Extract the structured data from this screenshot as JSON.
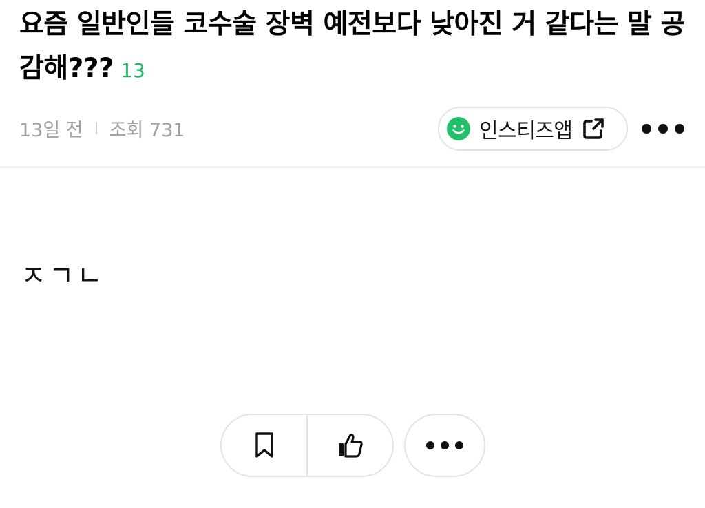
{
  "post": {
    "title": "요즘 일반인들 코수술 장벽 예전보다 낮아진 거 같다는 말 공감해???",
    "comment_count": "13",
    "time_ago": "13일 전",
    "views": "조회 731",
    "body": "ㅈㄱㄴ"
  },
  "header_actions": {
    "app_button_label": "인스티즈앱",
    "app_button_icon": "smile-icon",
    "external_icon": "external-link-icon",
    "more_icon": "more-dots-icon"
  },
  "bottom_actions": {
    "bookmark_icon": "bookmark-icon",
    "like_icon": "thumbs-up-icon",
    "more_icon": "more-dots-icon"
  },
  "colors": {
    "accent_green": "#22b866",
    "meta_gray": "#a0a0a0",
    "border_gray": "#e4e4e4"
  }
}
